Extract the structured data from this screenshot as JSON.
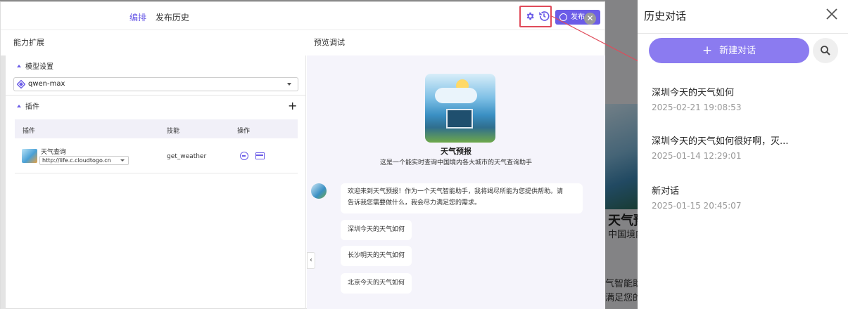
{
  "background": {
    "title_fragment": "天气预",
    "subtitle_fragment": "中国境内",
    "line1_fragment": "气智能助",
    "line2_fragment": "满足您的"
  },
  "editor": {
    "tabs": [
      {
        "label": "编排",
        "active": true
      },
      {
        "label": "发布历史",
        "active": false
      }
    ],
    "publish_label": "发布",
    "left_header": "能力扩展",
    "right_header": "预览调试",
    "model_section": "模型设置",
    "model_value": "qwen-max",
    "plugin_section": "插件",
    "plugin_columns": {
      "plugin": "插件",
      "skill": "技能",
      "ops": "操作"
    },
    "plugin": {
      "name": "天气查询",
      "url": "http://life.c.cloudtogo.cn",
      "skill": "get_weather"
    }
  },
  "preview": {
    "bot_name": "天气预报",
    "bot_desc": "这是一个能实时查询中国境内各大城市的天气查询助手",
    "welcome_line1": "欢迎来到天气预报！作为一个天气智能助手，我将竭尽所能为您提供帮助。请",
    "welcome_line2": "告诉我您需要做什么，我会尽力满足您的需求。",
    "suggestions": [
      "深圳今天的天气如何",
      "长沙明天的天气如何",
      "北京今天的天气如何"
    ]
  },
  "history": {
    "title": "历史对话",
    "new_chat_label": "新建对话",
    "items": [
      {
        "title": "深圳今天的天气如何",
        "time": "2025-02-21 19:08:53"
      },
      {
        "title": "深圳今天的天气如何很好啊，灭...",
        "time": "2025-01-14 12:29:01"
      },
      {
        "title": "新对话",
        "time": "2025-01-15 20:45:07"
      }
    ]
  },
  "colors": {
    "accent": "#6b5ce7",
    "new_chat": "#8b7bf0",
    "highlight": "#e04b5a"
  }
}
